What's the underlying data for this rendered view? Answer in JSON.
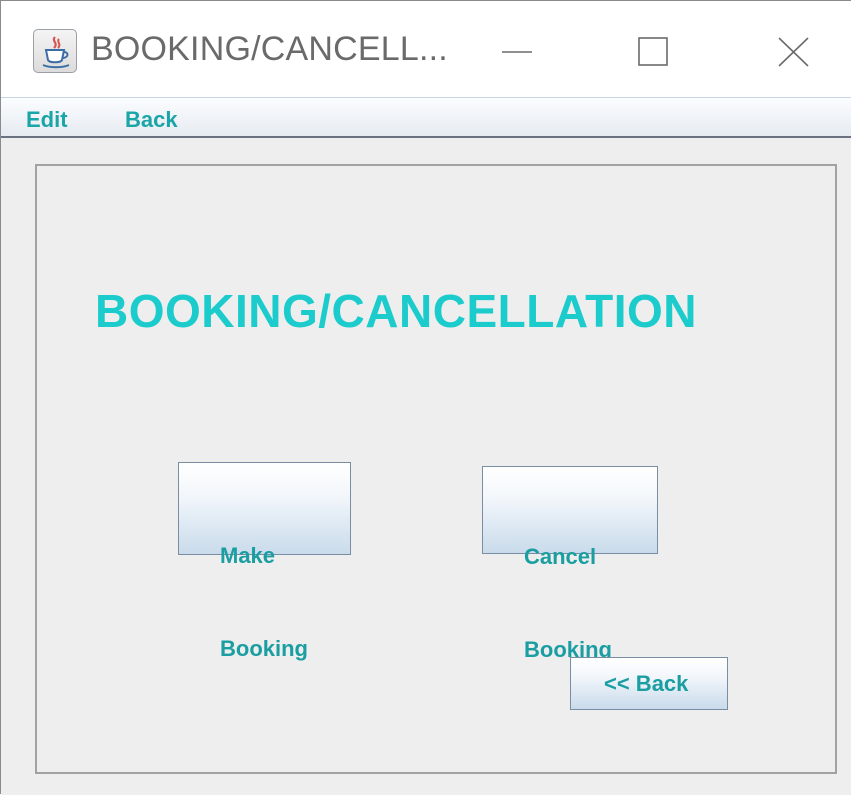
{
  "window": {
    "title": "BOOKING/CANCELL...",
    "icon": "java-cup-icon",
    "controls": [
      "minimize-icon",
      "maximize-icon",
      "close-icon"
    ]
  },
  "menubar": {
    "items": [
      {
        "label": "Edit"
      },
      {
        "label": "Back"
      }
    ]
  },
  "main": {
    "heading": "BOOKING/CANCELLATION",
    "make_booking": {
      "line1": "Make",
      "line2": "Booking"
    },
    "cancel_booking": {
      "line1": "Cancel",
      "line2": "Booking"
    },
    "back_button": "<< Back"
  },
  "colors": {
    "accent_text": "#1aa5a8",
    "heading": "#1ccbcb",
    "background": "#eeeeee"
  }
}
